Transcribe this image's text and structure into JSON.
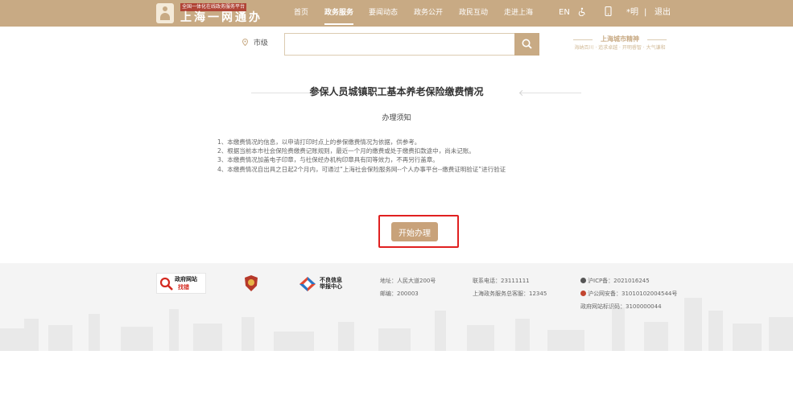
{
  "header": {
    "logo_subtitle": "全国一体化在线政务服务平台",
    "logo_title": "上海一网通办",
    "nav": [
      {
        "label": "首页",
        "active": false
      },
      {
        "label": "政务服务",
        "active": true
      },
      {
        "label": "要闻动态",
        "active": false
      },
      {
        "label": "政务公开",
        "active": false
      },
      {
        "label": "政民互动",
        "active": false
      },
      {
        "label": "走进上海",
        "active": false
      }
    ],
    "lang_label": "EN",
    "user_label": "*明",
    "separator": "|",
    "logout_label": "退出",
    "icons": [
      "accessibility-icon",
      "mobile-icon"
    ]
  },
  "search": {
    "region_label": "市级",
    "placeholder": "",
    "button_icon": "search-icon"
  },
  "badge": {
    "title": "上海城市精神",
    "subtitle": "海纳百川 · 追求卓越 · 开明睿智 · 大气谦和"
  },
  "main": {
    "title": "参保人员城镇职工基本养老保险缴费情况",
    "notice_title": "办理须知",
    "notes": [
      "1、本缴费情况的信息，以申请打印时点上的参保缴费情况为依据，供参考。",
      "2、根据当前本市社会保险费缴费记账规则，最近一个月的缴费或处于缴费扣款途中，尚未记账。",
      "3、本缴费情况加盖电子印章，与社保经办机构印章具有同等效力，不再另行盖章。",
      "4、本缴费情况自出具之日起2个月内，可通过“上海社会保险服务网--个人办事平台--缴费证明验证”进行验证"
    ],
    "start_button": "开始办理"
  },
  "footer": {
    "gov_site_label_1": "政府网站",
    "gov_site_label_2": "找错",
    "report_label_1": "不良信息",
    "report_label_2": "举报中心",
    "address": "地址：人民大道200号",
    "postcode": "邮编：200003",
    "phone": "联系电话：23111111",
    "hotline": "上海政务服务总客服：12345",
    "icp": "沪ICP备：2021016245",
    "police": "沪公网安备：31010102004544号",
    "site_code": "政府网站标识码：3100000044"
  },
  "colors": {
    "header_bg": "#c8aa84",
    "accent": "#c8a27a",
    "highlight": "#e02020",
    "footer_bg": "#f4f4f4"
  }
}
